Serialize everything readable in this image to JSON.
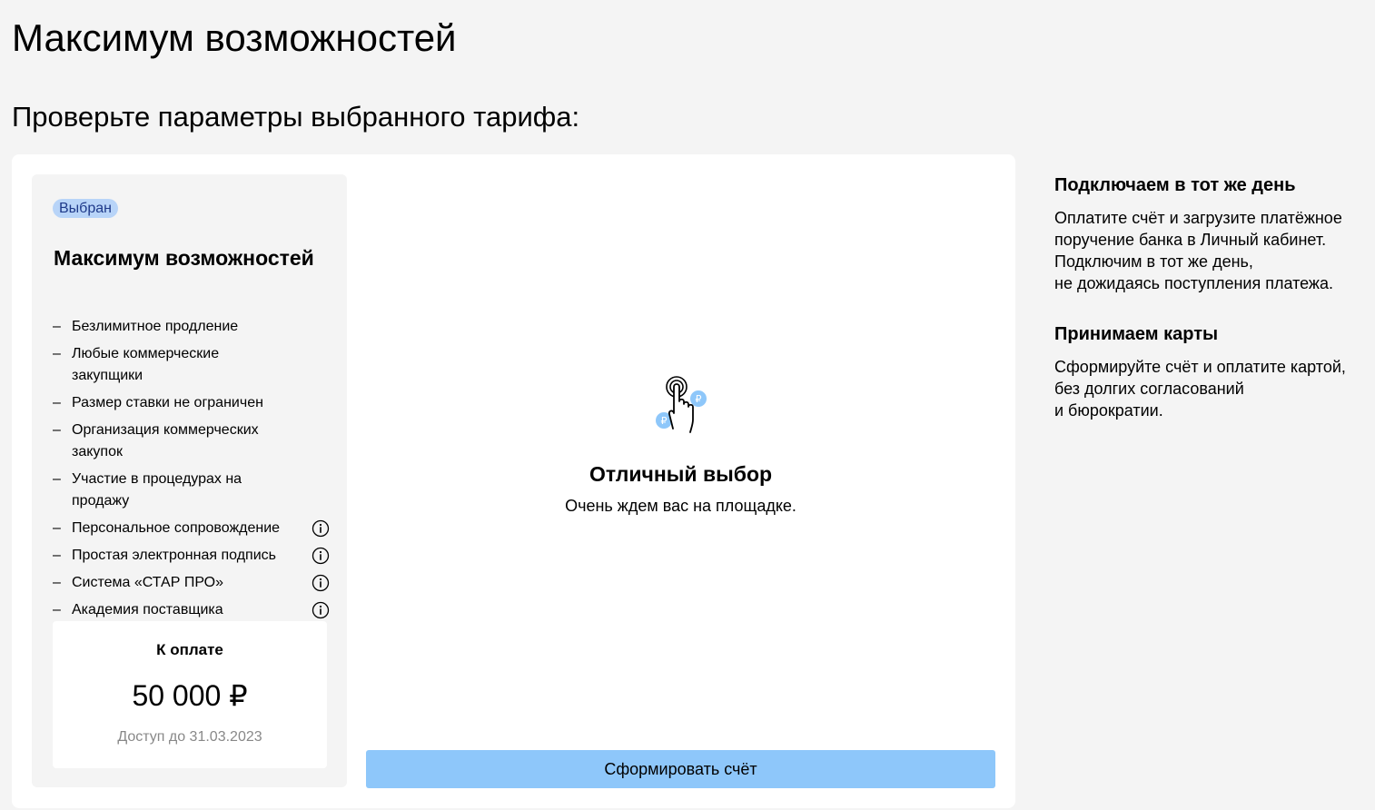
{
  "page": {
    "title": "Максимум возможностей",
    "subtitle": "Проверьте параметры выбранного тарифа:"
  },
  "tariff": {
    "badge": "Выбран",
    "name": "Максимум возможностей",
    "features": [
      {
        "text": "Безлимитное продление",
        "info": false
      },
      {
        "text": "Любые коммерческие закупщики",
        "info": false
      },
      {
        "text": "Размер ставки не ограничен",
        "info": false
      },
      {
        "text": "Организация коммерческих закупок",
        "info": false
      },
      {
        "text": "Участие в процедурах на продажу",
        "info": false
      },
      {
        "text": "Персональное сопровождение",
        "info": true
      },
      {
        "text": "Простая электронная подпись",
        "info": true
      },
      {
        "text": "Система «СТАР ПРО»",
        "info": true
      },
      {
        "text": "Академия поставщика",
        "info": true
      }
    ],
    "dash": "–",
    "payment": {
      "label": "К оплате",
      "amount": "50 000 ₽",
      "access": "Доступ до 31.03.2023"
    }
  },
  "center": {
    "icon": "hand-tap-icon",
    "title": "Отличный выбор",
    "text": "Очень ждем вас на площадке."
  },
  "button": {
    "label": "Сформировать счёт"
  },
  "side": {
    "blocks": [
      {
        "heading": "Подключаем в тот же день",
        "text": "Оплатите счёт и загрузите платёжное\nпоручение банка в Личный кабинет.\nПодключим в тот же день,\nне дожидаясь поступления платежа."
      },
      {
        "heading": "Принимаем карты",
        "text": "Сформируйте счёт и оплатите картой,\nбез долгих согласований\nи бюрократии."
      }
    ]
  },
  "colors": {
    "badge_bg": "#b8d4f8",
    "button_bg": "#8ec7fa",
    "coin": "#8ec7fa"
  }
}
